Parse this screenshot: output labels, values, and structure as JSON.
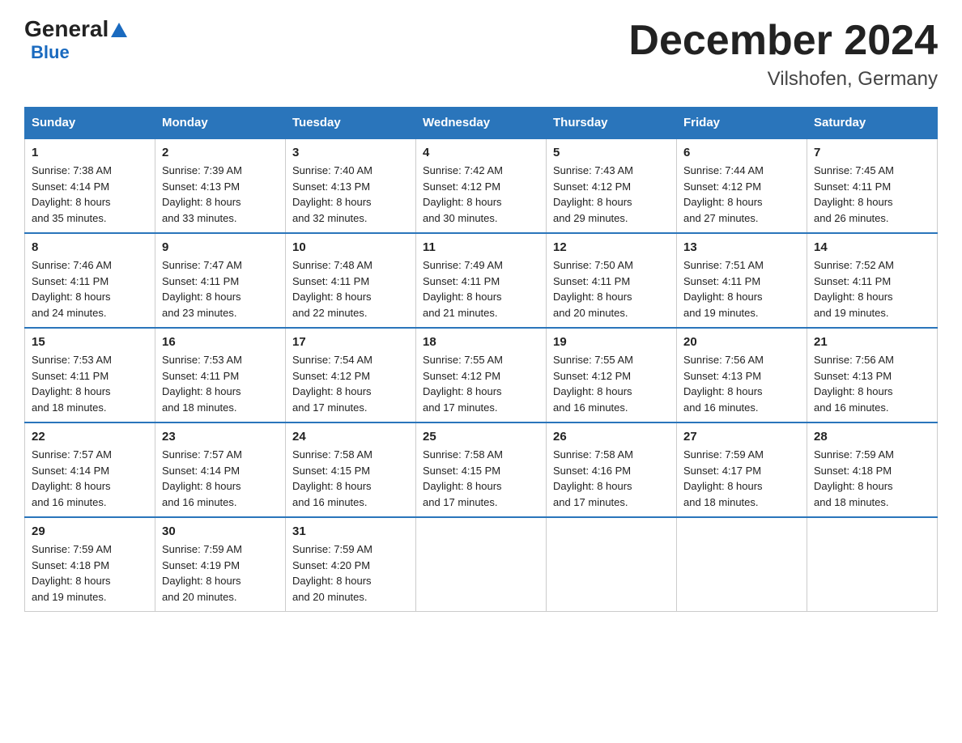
{
  "logo": {
    "general": "General",
    "blue": "Blue"
  },
  "title": "December 2024",
  "subtitle": "Vilshofen, Germany",
  "weekdays": [
    "Sunday",
    "Monday",
    "Tuesday",
    "Wednesday",
    "Thursday",
    "Friday",
    "Saturday"
  ],
  "weeks": [
    [
      {
        "day": "1",
        "sunrise": "7:38 AM",
        "sunset": "4:14 PM",
        "daylight": "8 hours and 35 minutes."
      },
      {
        "day": "2",
        "sunrise": "7:39 AM",
        "sunset": "4:13 PM",
        "daylight": "8 hours and 33 minutes."
      },
      {
        "day": "3",
        "sunrise": "7:40 AM",
        "sunset": "4:13 PM",
        "daylight": "8 hours and 32 minutes."
      },
      {
        "day": "4",
        "sunrise": "7:42 AM",
        "sunset": "4:12 PM",
        "daylight": "8 hours and 30 minutes."
      },
      {
        "day": "5",
        "sunrise": "7:43 AM",
        "sunset": "4:12 PM",
        "daylight": "8 hours and 29 minutes."
      },
      {
        "day": "6",
        "sunrise": "7:44 AM",
        "sunset": "4:12 PM",
        "daylight": "8 hours and 27 minutes."
      },
      {
        "day": "7",
        "sunrise": "7:45 AM",
        "sunset": "4:11 PM",
        "daylight": "8 hours and 26 minutes."
      }
    ],
    [
      {
        "day": "8",
        "sunrise": "7:46 AM",
        "sunset": "4:11 PM",
        "daylight": "8 hours and 24 minutes."
      },
      {
        "day": "9",
        "sunrise": "7:47 AM",
        "sunset": "4:11 PM",
        "daylight": "8 hours and 23 minutes."
      },
      {
        "day": "10",
        "sunrise": "7:48 AM",
        "sunset": "4:11 PM",
        "daylight": "8 hours and 22 minutes."
      },
      {
        "day": "11",
        "sunrise": "7:49 AM",
        "sunset": "4:11 PM",
        "daylight": "8 hours and 21 minutes."
      },
      {
        "day": "12",
        "sunrise": "7:50 AM",
        "sunset": "4:11 PM",
        "daylight": "8 hours and 20 minutes."
      },
      {
        "day": "13",
        "sunrise": "7:51 AM",
        "sunset": "4:11 PM",
        "daylight": "8 hours and 19 minutes."
      },
      {
        "day": "14",
        "sunrise": "7:52 AM",
        "sunset": "4:11 PM",
        "daylight": "8 hours and 19 minutes."
      }
    ],
    [
      {
        "day": "15",
        "sunrise": "7:53 AM",
        "sunset": "4:11 PM",
        "daylight": "8 hours and 18 minutes."
      },
      {
        "day": "16",
        "sunrise": "7:53 AM",
        "sunset": "4:11 PM",
        "daylight": "8 hours and 18 minutes."
      },
      {
        "day": "17",
        "sunrise": "7:54 AM",
        "sunset": "4:12 PM",
        "daylight": "8 hours and 17 minutes."
      },
      {
        "day": "18",
        "sunrise": "7:55 AM",
        "sunset": "4:12 PM",
        "daylight": "8 hours and 17 minutes."
      },
      {
        "day": "19",
        "sunrise": "7:55 AM",
        "sunset": "4:12 PM",
        "daylight": "8 hours and 16 minutes."
      },
      {
        "day": "20",
        "sunrise": "7:56 AM",
        "sunset": "4:13 PM",
        "daylight": "8 hours and 16 minutes."
      },
      {
        "day": "21",
        "sunrise": "7:56 AM",
        "sunset": "4:13 PM",
        "daylight": "8 hours and 16 minutes."
      }
    ],
    [
      {
        "day": "22",
        "sunrise": "7:57 AM",
        "sunset": "4:14 PM",
        "daylight": "8 hours and 16 minutes."
      },
      {
        "day": "23",
        "sunrise": "7:57 AM",
        "sunset": "4:14 PM",
        "daylight": "8 hours and 16 minutes."
      },
      {
        "day": "24",
        "sunrise": "7:58 AM",
        "sunset": "4:15 PM",
        "daylight": "8 hours and 16 minutes."
      },
      {
        "day": "25",
        "sunrise": "7:58 AM",
        "sunset": "4:15 PM",
        "daylight": "8 hours and 17 minutes."
      },
      {
        "day": "26",
        "sunrise": "7:58 AM",
        "sunset": "4:16 PM",
        "daylight": "8 hours and 17 minutes."
      },
      {
        "day": "27",
        "sunrise": "7:59 AM",
        "sunset": "4:17 PM",
        "daylight": "8 hours and 18 minutes."
      },
      {
        "day": "28",
        "sunrise": "7:59 AM",
        "sunset": "4:18 PM",
        "daylight": "8 hours and 18 minutes."
      }
    ],
    [
      {
        "day": "29",
        "sunrise": "7:59 AM",
        "sunset": "4:18 PM",
        "daylight": "8 hours and 19 minutes."
      },
      {
        "day": "30",
        "sunrise": "7:59 AM",
        "sunset": "4:19 PM",
        "daylight": "8 hours and 20 minutes."
      },
      {
        "day": "31",
        "sunrise": "7:59 AM",
        "sunset": "4:20 PM",
        "daylight": "8 hours and 20 minutes."
      },
      null,
      null,
      null,
      null
    ]
  ],
  "labels": {
    "sunrise": "Sunrise:",
    "sunset": "Sunset:",
    "daylight": "Daylight:"
  }
}
